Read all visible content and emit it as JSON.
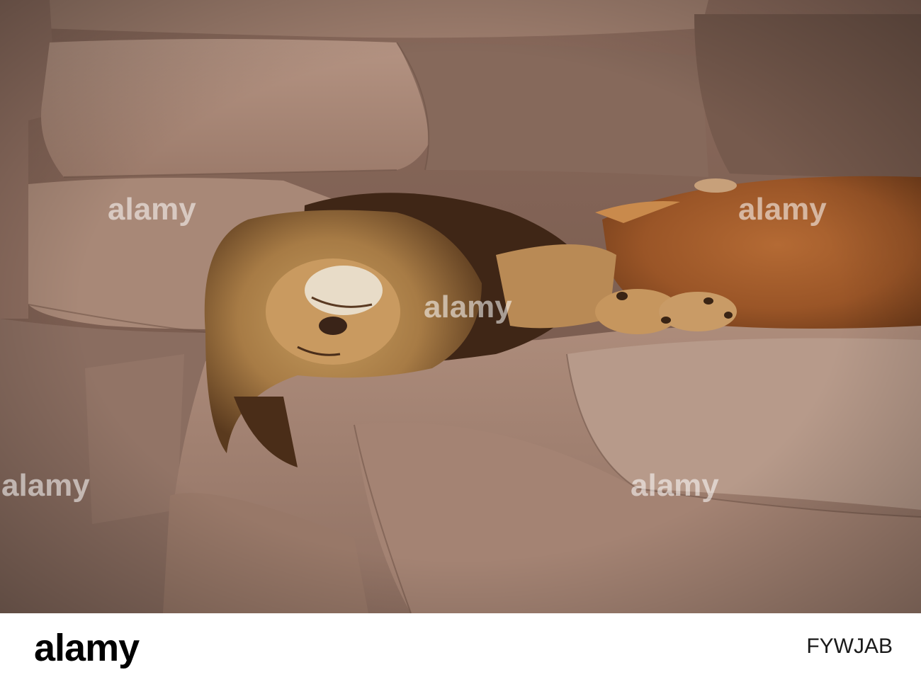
{
  "photo": {
    "subject": "lion-sleeping-on-rock",
    "watermark_text": "alamy"
  },
  "footer": {
    "logo_text": "alamy",
    "image_id": "FYWJAB"
  }
}
